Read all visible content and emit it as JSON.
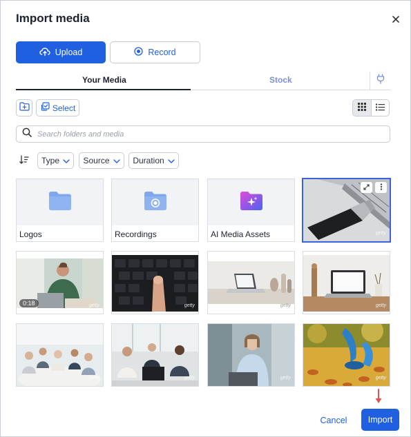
{
  "dialog": {
    "title": "Import media",
    "close_icon": "close-icon"
  },
  "mode": {
    "upload_label": "Upload",
    "record_label": "Record",
    "upload_icon": "cloud-upload-icon",
    "record_icon": "record-icon",
    "active": "Upload"
  },
  "tabs": {
    "your_media": "Your Media",
    "stock": "Stock",
    "plugin_icon": "plug-icon",
    "active": "Your Media"
  },
  "toolbar": {
    "select_label": "Select",
    "new_folder_icon": "folder-plus-icon",
    "view_active": "grid"
  },
  "search": {
    "placeholder": "Search folders and media",
    "value": ""
  },
  "filters": {
    "type": "Type",
    "source": "Source",
    "duration": "Duration"
  },
  "folders": [
    {
      "label": "Logos",
      "icon": "folder-icon"
    },
    {
      "label": "Recordings",
      "icon": "record-folder-icon"
    },
    {
      "label": "AI Media Assets",
      "icon": "ai-sparkle-folder-icon"
    }
  ],
  "media": [
    {
      "subject": "USB flash drive plugged into laptop",
      "watermark": "getty",
      "selected": true
    },
    {
      "subject": "Man working at laptop",
      "watermark": "getty",
      "duration": "0:18"
    },
    {
      "subject": "Finger on keyboard",
      "watermark": "getty"
    },
    {
      "subject": "Laptop on desk with vases",
      "watermark": "getty"
    },
    {
      "subject": "Laptop on wooden desk",
      "watermark": "getty"
    },
    {
      "subject": "Business meeting at table",
      "watermark": "getty"
    },
    {
      "subject": "Team applauding at laptops",
      "watermark": "getty"
    },
    {
      "subject": "Woman smiling at laptop",
      "watermark": "getty"
    },
    {
      "subject": "Person tying shoe in autumn leaves",
      "watermark": "getty"
    }
  ],
  "footer": {
    "cancel_label": "Cancel",
    "import_label": "Import"
  },
  "colors": {
    "accent": "#1f5fe0",
    "arrow": "#e0524c",
    "selected_border": "#3b63d9"
  }
}
